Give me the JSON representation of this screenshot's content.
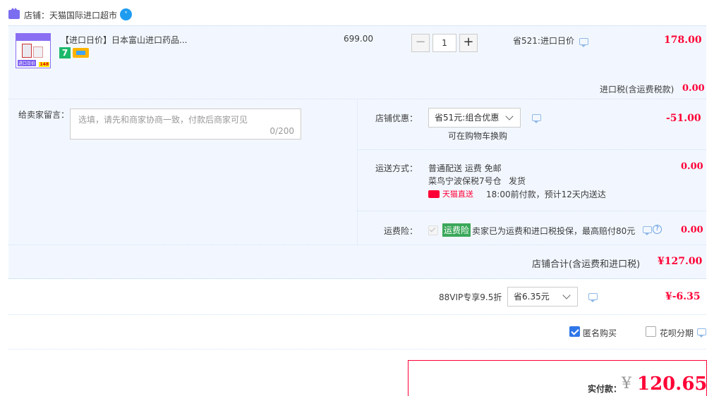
{
  "store": {
    "label": "店铺：",
    "name": "天猫国际进口超市"
  },
  "item": {
    "thumb_text": "进口日价",
    "thumb_price": "148",
    "title": "【进口日价】日本富山进口药品...",
    "badge_seven": "7",
    "unit_price": "699.00",
    "quantity": "1",
    "minus": "−",
    "plus": "+",
    "discount_text": "省521:进口日价",
    "subtotal": "178.00"
  },
  "tax": {
    "label": "进口税(含运费税款)",
    "value": "0.00"
  },
  "message": {
    "label": "给卖家留言：",
    "placeholder": "选填，请先和商家协商一致，付款后商家可见",
    "counter": "0/200"
  },
  "store_discount": {
    "label": "店铺优惠：",
    "selected": "省51元:组合优惠",
    "note": "可在购物车换购",
    "value": "-51.00"
  },
  "shipping": {
    "label": "运送方式：",
    "method": "普通配送 运费 免邮",
    "warehouse": "菜鸟宁波保税7号仓",
    "dispatch": "发货",
    "direct_badge": "天猫直送",
    "eta": "18:00前付款，预计12天内送达",
    "value": "0.00"
  },
  "insurance": {
    "label": "运费险：",
    "tag": "运费险",
    "text": "卖家已为运费和进口税投保，最高赔付80元",
    "help": "?",
    "value": "0.00"
  },
  "store_total": {
    "label": "店铺合计(含运费和进口税)",
    "value": "¥127.00"
  },
  "vip": {
    "label": "88VIP专享9.5折",
    "selected": "省6.35元",
    "value": "¥-6.35"
  },
  "options": {
    "anonymous": "匿名购买",
    "installment": "花呗分期"
  },
  "payment": {
    "label": "实付款：",
    "currency": "¥",
    "amount": "120.65"
  },
  "colors": {
    "accent_red": "#ff0036",
    "block_bg": "#f2f7ff",
    "checkbox_blue": "#2f77e8",
    "insurance_green": "#3aa85a"
  }
}
